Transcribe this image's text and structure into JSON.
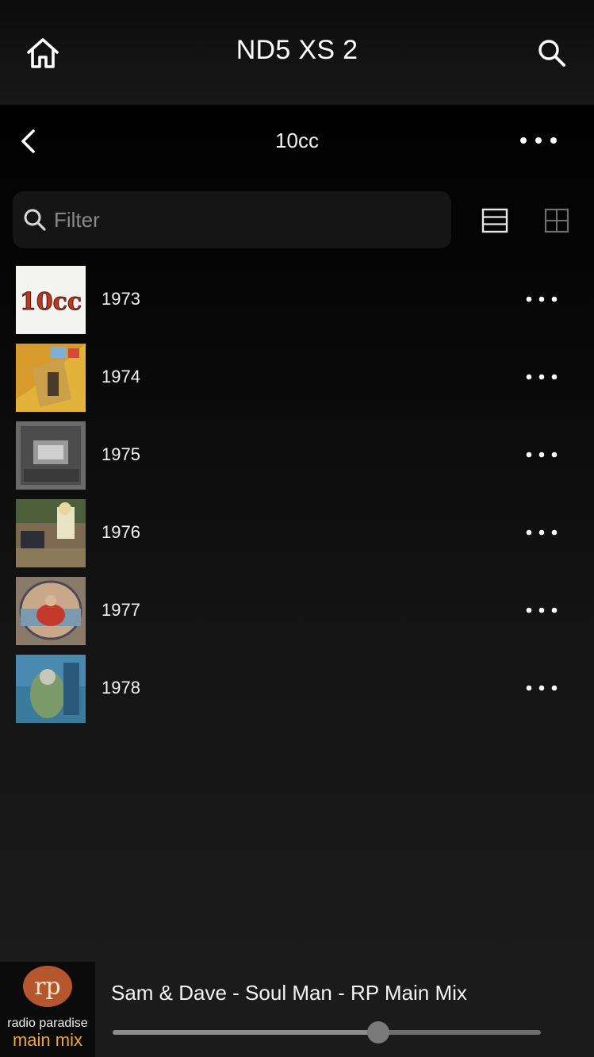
{
  "header": {
    "title": "ND5 XS 2",
    "home_icon": "home-icon",
    "search_icon": "search-icon"
  },
  "subheader": {
    "title": "10cc",
    "back_icon": "chevron-left-icon",
    "more_icon": "more-horizontal-icon"
  },
  "filter": {
    "placeholder": "Filter",
    "value": ""
  },
  "view_modes": [
    "list-view-icon",
    "grid-view-icon"
  ],
  "albums": [
    {
      "year": "1973"
    },
    {
      "year": "1974"
    },
    {
      "year": "1975"
    },
    {
      "year": "1976"
    },
    {
      "year": "1977"
    },
    {
      "year": "1978"
    }
  ],
  "now_playing": {
    "station_line1": "radio paradise",
    "station_line2": "main mix",
    "logo_text": "rp",
    "track": "Sam & Dave - Soul Man - RP Main Mix",
    "progress": 0.62
  },
  "colors": {
    "accent": "#f0a53a",
    "logo_bg": "#b5562c"
  }
}
